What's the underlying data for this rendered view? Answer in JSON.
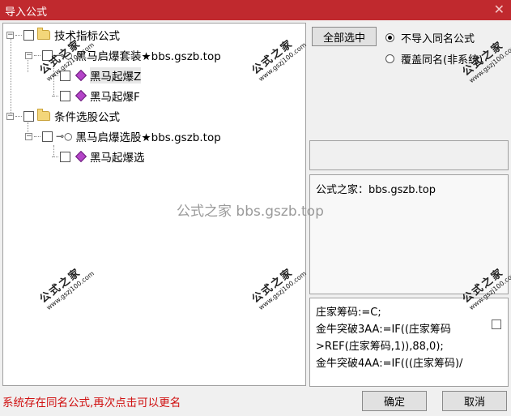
{
  "window": {
    "title": "导入公式",
    "close_glyph": "✕"
  },
  "tree": {
    "nodes": [
      {
        "label": "技术指标公式"
      },
      {
        "label": "黑马启爆套装★bbs.gszb.top"
      },
      {
        "label": "黑马起爆Z"
      },
      {
        "label": "黑马起爆F"
      },
      {
        "label": "条件选股公式"
      },
      {
        "label": "黑马启爆选股★bbs.gszb.top"
      },
      {
        "label": "黑马起爆选"
      }
    ]
  },
  "controls": {
    "select_all": "全部选中",
    "radio_skip": "不导入同名公式",
    "radio_overwrite": "覆盖同名(非系统)",
    "selected_radio": "radio_skip"
  },
  "info": {
    "text": "公式之家：bbs.gszb.top"
  },
  "code": {
    "lines": [
      "庄家筹码:=C;",
      "金牛突破3AA:=IF((庄家筹码",
      ">REF(庄家筹码,1)),88,0);",
      "金牛突破4AA:=IF(((庄家筹码)/"
    ]
  },
  "status_text": "系统存在同名公式,再次点击可以更名",
  "buttons": {
    "ok": "确定",
    "cancel": "取消"
  },
  "watermarks": {
    "center": "公式之家 bbs.gszb.top",
    "stamp_big": "公式之家",
    "stamp_small": "www.gszj100.com"
  }
}
